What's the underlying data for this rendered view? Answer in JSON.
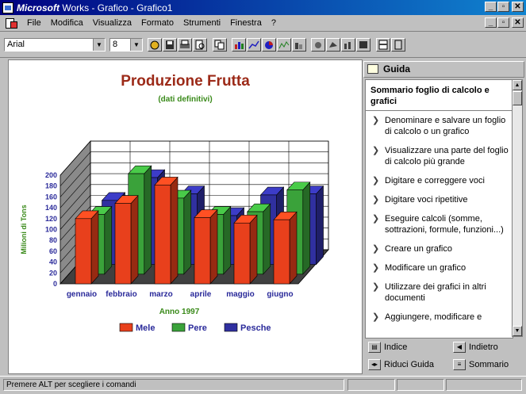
{
  "window": {
    "brand": "Microsoft",
    "title_rest": " Works - Grafico - Grafico1"
  },
  "menu": [
    {
      "label": "File"
    },
    {
      "label": "Modifica"
    },
    {
      "label": "Visualizza"
    },
    {
      "label": "Formato"
    },
    {
      "label": "Strumenti"
    },
    {
      "label": "Finestra"
    },
    {
      "label": "?"
    }
  ],
  "toolbar": {
    "font_name": "Arial",
    "font_size": "8"
  },
  "chart_data": {
    "type": "bar",
    "title": "Produzione Frutta",
    "subtitle": "(dati definitivi)",
    "xlabel": "Anno 1997",
    "ylabel": "Milioni di Tons",
    "ylim": [
      0,
      200
    ],
    "yticks": [
      "0",
      "20",
      "40",
      "60",
      "80",
      "100",
      "120",
      "140",
      "160",
      "180",
      "200"
    ],
    "categories": [
      "gennaio",
      "febbraio",
      "marzo",
      "aprile",
      "maggio",
      "giugno"
    ],
    "series": [
      {
        "name": "Mele",
        "color": "#e8401c",
        "values": [
          120,
          148,
          182,
          122,
          112,
          118
        ]
      },
      {
        "name": "Pere",
        "color": "#3aa23a",
        "values": [
          110,
          185,
          140,
          110,
          115,
          155
        ]
      },
      {
        "name": "Pesche",
        "color": "#3030a0",
        "values": [
          118,
          160,
          130,
          90,
          128,
          130
        ]
      }
    ],
    "legend": "bottom",
    "grid": true
  },
  "guida": {
    "header": "Guida",
    "heading": "Sommario foglio di calcolo e grafici",
    "items": [
      "Denominare e salvare un foglio di calcolo o un grafico",
      "Visualizzare una parte del foglio di calcolo più grande",
      "Digitare e correggere voci",
      "Digitare voci ripetitive",
      "Eseguire calcoli (somme, sottrazioni, formule, funzioni...)",
      "Creare un grafico",
      "Modificare un grafico",
      "Utilizzare dei grafici in altri documenti",
      "Aggiungere, modificare e"
    ],
    "btn_indice": "Indice",
    "btn_indietro": "Indietro",
    "btn_riduci": "Riduci Guida",
    "btn_sommario": "Sommario"
  },
  "status": {
    "text": "Premere ALT per scegliere i comandi"
  }
}
